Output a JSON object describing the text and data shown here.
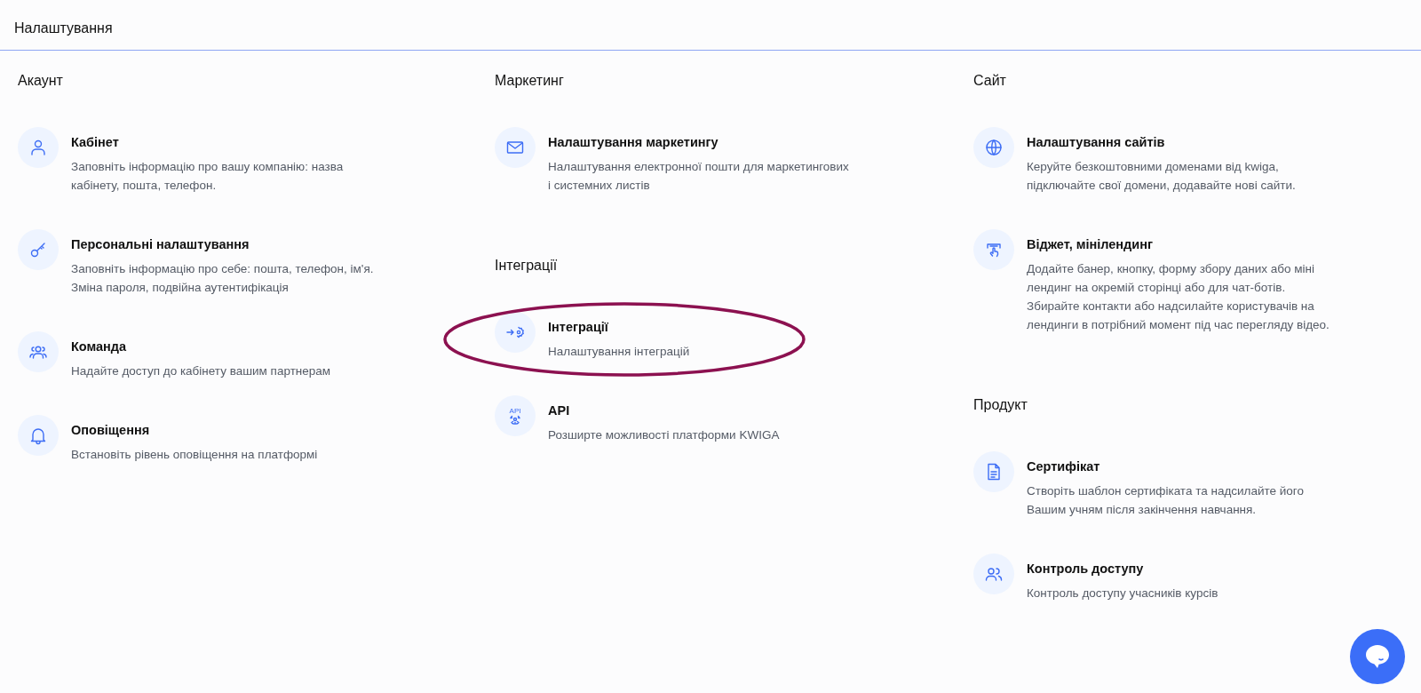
{
  "header": {
    "title": "Налаштування"
  },
  "columns": [
    {
      "sections": [
        {
          "heading": "Акаунт",
          "items": [
            {
              "title": "Кабінет",
              "description": "Заповніть інформацію про вашу компанію: назва\nкабінету, пошта, телефон.",
              "highlighted": false
            },
            {
              "title": "Персональні налаштування",
              "description": "Заповніть інформацію про себе: пошта, телефон, ім'я.\nЗміна пароля, подвійна аутентифікація",
              "highlighted": false
            },
            {
              "title": "Команда",
              "description": "Надайте доступ до кабінету вашим партнерам",
              "highlighted": false
            },
            {
              "title": "Оповіщення",
              "description": "Встановіть рівень оповіщення на платформі",
              "highlighted": false
            }
          ]
        }
      ]
    },
    {
      "sections": [
        {
          "heading": "Маркетинг",
          "items": [
            {
              "title": "Налаштування маркетингу",
              "description": "Налаштування електронної пошти для маркетингових\nі системних листів",
              "highlighted": false
            }
          ]
        },
        {
          "heading": "Інтеграції",
          "items": [
            {
              "title": "Інтеграції",
              "description": "Налаштування інтеграцій",
              "highlighted": true
            },
            {
              "icon_label": "API",
              "title": "API",
              "description": "Розширте можливості платформи KWIGA",
              "highlighted": false
            }
          ]
        }
      ]
    },
    {
      "sections": [
        {
          "heading": "Сайт",
          "items": [
            {
              "title": "Налаштування сайтів",
              "description": "Керуйте безкоштовними доменами від kwiga,\nпідключайте свої домени, додавайте нові сайти.",
              "highlighted": false
            },
            {
              "title": "Віджет, мінілендинг",
              "description": "Додайте банер, кнопку, форму збору даних або міні\nлендинг на окремій сторінці або для чат-ботів.\nЗбирайте контакти або надсилайте користувачів на\nлендинги в потрібний момент під час перегляду відео.",
              "highlighted": false
            }
          ]
        },
        {
          "heading": "Продукт",
          "items": [
            {
              "title": "Сертифікат",
              "description": "Створіть шаблон сертифіката та надсилайте його\nВашим учням після закінчення навчання.",
              "highlighted": false
            },
            {
              "title": "Контроль доступу",
              "description": "Контроль доступу учасників курсів",
              "highlighted": false
            }
          ]
        }
      ]
    }
  ]
}
